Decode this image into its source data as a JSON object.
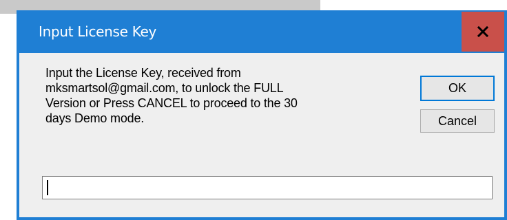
{
  "dialog": {
    "title": "Input License Key",
    "close_label": "x",
    "message_lines": [
      "Input the  License Key, received from",
      "mksmartsol@gmail.com, to unlock the FULL",
      "Version or Press CANCEL to proceed to the 30",
      "days Demo mode."
    ],
    "ok_label": "OK",
    "cancel_label": "Cancel",
    "input_value": ""
  },
  "colors": {
    "titlebar": "#1f7fd4",
    "close_button": "#c9504a",
    "client_background": "#efefef"
  },
  "icons": {
    "close": "close-icon"
  }
}
